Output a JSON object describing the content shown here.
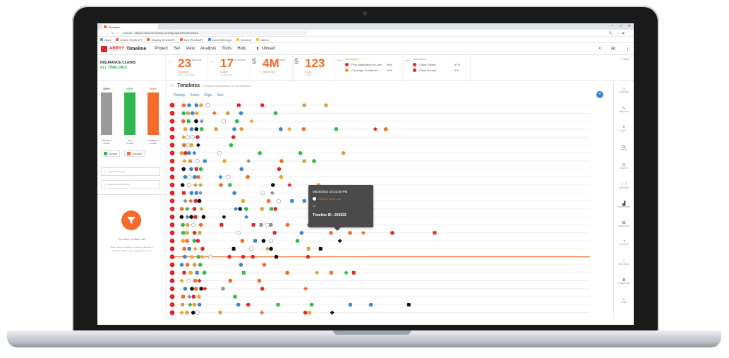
{
  "browser": {
    "tab_title": "Timelines",
    "url": "https://online.timelinepi.com/#/project/491/timelines",
    "secure_label": "Secure",
    "bookmarks": [
      "Apps",
      "Online TimelinePI",
      "Staging TimelinePI",
      "Dev TimelinePI",
      "Zoom Meetings",
      "General",
      "Videos"
    ],
    "bookmark_colors": [
      "#6c8ebf",
      "#f26b2a",
      "#f26b2a",
      "#f26b2a",
      "#2d8cff",
      "#f2c12e",
      "#f2c12e"
    ]
  },
  "app": {
    "brand": "ABBYY",
    "product": "Timeline",
    "menu": [
      "Project",
      "Set",
      "View",
      "Analysis",
      "Tools",
      "Help"
    ],
    "upload_label": "Upload"
  },
  "project": {
    "name": "INSURANCE CLAIMS",
    "view": "ALL TIMELINES"
  },
  "metrics": [
    {
      "icon": "clock-icon",
      "value": "23",
      "unit": "days AVG",
      "label": "Duration",
      "sub": "4 hrs - 13 months"
    },
    {
      "icon": "events-icon",
      "value": "17",
      "unit": "events AVG",
      "label": "Count",
      "sub": "3 - 36 events"
    },
    {
      "icon": "dollar-icon",
      "value": "4M",
      "unit": "TOTAL",
      "label": "Total cost",
      "sub": ""
    },
    {
      "icon": "dollar-icon",
      "value": "123",
      "unit": "AVG",
      "label": "Cost",
      "sub": "0 - 2K"
    }
  ],
  "first_event": {
    "header": "First event",
    "rows": [
      {
        "label": "First Notification of Loss",
        "pct": "89%"
      },
      {
        "label": "Coverage Confirmed",
        "pct": "10%"
      }
    ]
  },
  "last_event": {
    "header": "Last event",
    "rows": [
      {
        "label": "Claim Closed",
        "pct": "87%"
      },
      {
        "label": "Claim Denied",
        "pct": "5%"
      }
    ]
  },
  "sets": [
    {
      "pct": "100%",
      "label": "PROJECT",
      "count": "25,396",
      "color": "#9a9a9a",
      "fill": 1.0
    },
    {
      "pct": "100%",
      "label": "SET",
      "count": "25,396",
      "color": "#2eb84f",
      "fill": 1.0
    },
    {
      "pct": "100%",
      "label": "CURRENT",
      "count": "25,396",
      "color": "#f26b2a",
      "fill": 1.0
    }
  ],
  "filters": {
    "filters_label": "FILTERS",
    "unsaved_label": "UNSAVED",
    "save_label": "Save filters as set",
    "remove_label": "Remove unsaved filters",
    "empty_title": "You have no filters set",
    "empty_desc": "Filters can be created by results of all sorts of analysis. Search, query, tagging and so on."
  },
  "timelines": {
    "title": "Timelines",
    "subtitle": "A visual representation of the timelines",
    "tools": [
      "Display",
      "Zoom",
      "Align",
      "Sort"
    ],
    "add_label": "+"
  },
  "tooltip": {
    "date": "05/28/2016 10:31:00 PM",
    "event": "Require More Info",
    "code": "#37",
    "id_text": "Timeline ID : 256922"
  },
  "rail": [
    "OVERVIEW",
    "TIMELINES",
    "QUERY",
    "PATHS",
    "EVENTS",
    "PATTERNS",
    "DISTRIBUTION",
    "WORKFLOW",
    "OUTLIERS",
    "DATA RUNS",
    "CONNECTORS",
    "MORE"
  ]
}
